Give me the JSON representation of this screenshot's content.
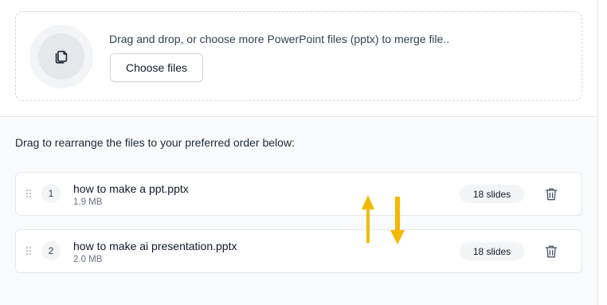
{
  "dropzone": {
    "icon": "file-copy-icon",
    "prompt": "Drag and drop, or choose more PowerPoint files (pptx) to merge file..",
    "choose_label": "Choose files"
  },
  "instructions": "Drag to rearrange the files to your preferred order below:",
  "files": [
    {
      "index": "1",
      "name": "how to make a ppt.pptx",
      "size": "1.9 MB",
      "slides": "18 slides"
    },
    {
      "index": "2",
      "name": "how to make ai presentation.pptx",
      "size": "2.0 MB",
      "slides": "18 slides"
    }
  ],
  "colors": {
    "accent_arrow": "#f5b800",
    "border": "#e5e7eb",
    "panel_bg": "#f9fafb"
  },
  "icons": {
    "drag_handle": "drag-handle-icon",
    "delete": "trash-icon",
    "reorder_hint": "reorder-arrows-icon"
  }
}
